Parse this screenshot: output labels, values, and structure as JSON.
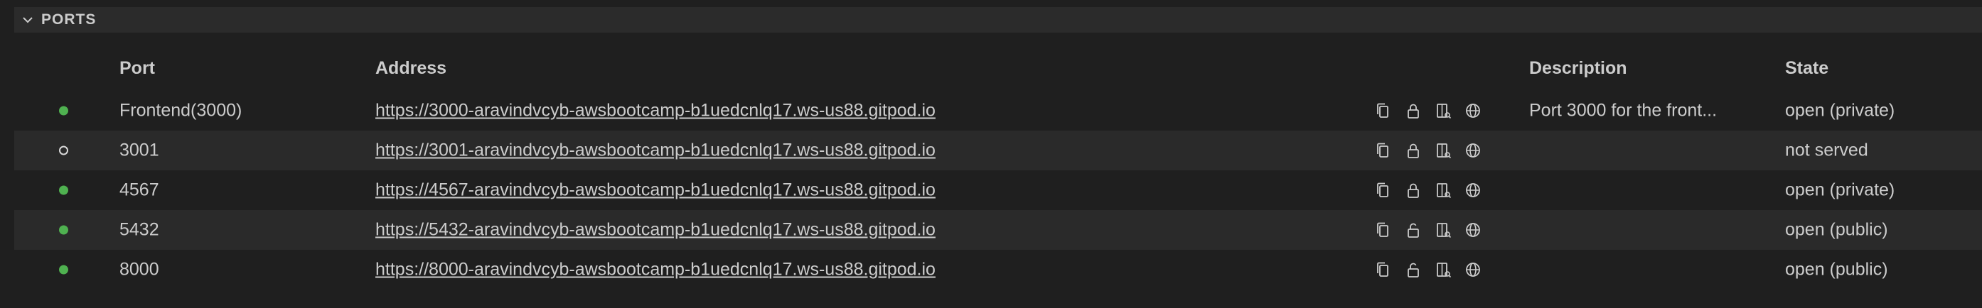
{
  "panel": {
    "title": "PORTS"
  },
  "columns": {
    "port": "Port",
    "address": "Address",
    "description": "Description",
    "state": "State"
  },
  "rows": [
    {
      "status": "running",
      "port": "Frontend(3000)",
      "address": "https://3000-aravindvcyb-awsbootcamp-b1uedcnlq17.ws-us88.gitpod.io",
      "lock": "locked",
      "description": "Port 3000 for the front...",
      "state": "open (private)"
    },
    {
      "status": "idle",
      "port": "3001",
      "address": "https://3001-aravindvcyb-awsbootcamp-b1uedcnlq17.ws-us88.gitpod.io",
      "lock": "locked",
      "description": "",
      "state": "not served"
    },
    {
      "status": "running",
      "port": "4567",
      "address": "https://4567-aravindvcyb-awsbootcamp-b1uedcnlq17.ws-us88.gitpod.io",
      "lock": "locked",
      "description": "",
      "state": "open (private)"
    },
    {
      "status": "running",
      "port": "5432",
      "address": "https://5432-aravindvcyb-awsbootcamp-b1uedcnlq17.ws-us88.gitpod.io",
      "lock": "unlocked",
      "description": "",
      "state": "open (public)"
    },
    {
      "status": "running",
      "port": "8000",
      "address": "https://8000-aravindvcyb-awsbootcamp-b1uedcnlq17.ws-us88.gitpod.io",
      "lock": "unlocked",
      "description": "",
      "state": "open (public)"
    }
  ],
  "icons": {
    "collapse": "chevron-down-icon",
    "copy": "copy-icon",
    "lock": "lock-icon",
    "unlock": "unlock-icon",
    "preview": "open-preview-icon",
    "browser": "globe-icon"
  },
  "colors": {
    "running": "#4fb150",
    "idle": "#d8d8d8"
  }
}
